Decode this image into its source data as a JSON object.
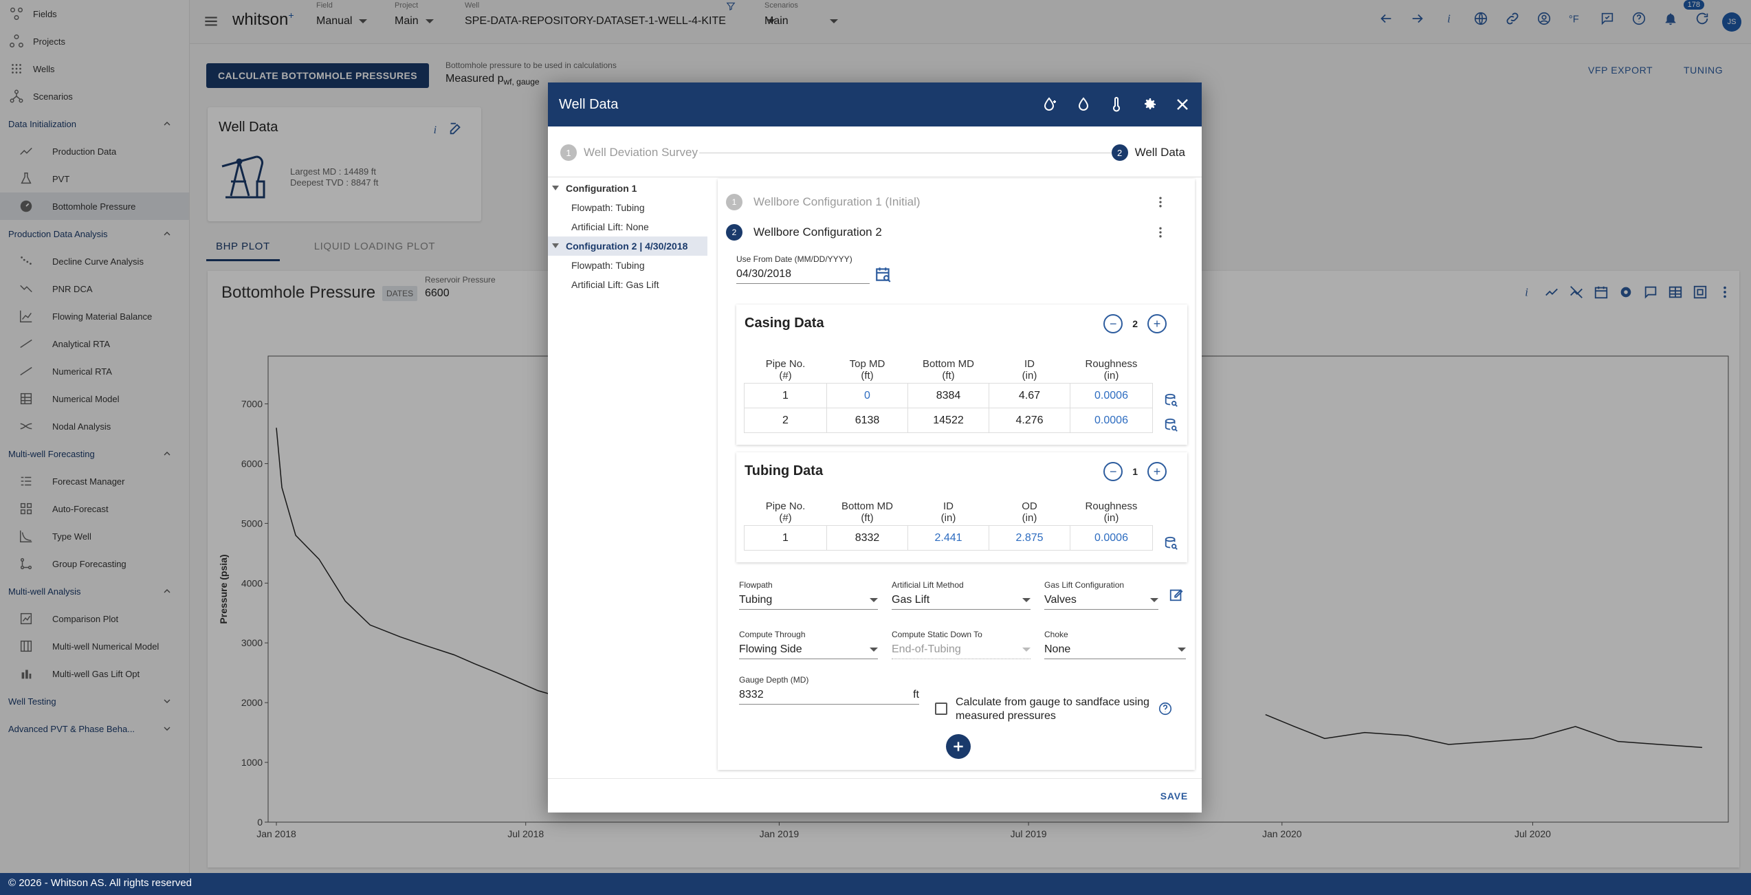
{
  "sidebar": {
    "top_items": [
      "Fields",
      "Projects",
      "Wells",
      "Scenarios"
    ],
    "sections": [
      {
        "title": "Data Initialization",
        "items": [
          "Production Data",
          "PVT",
          "Bottomhole Pressure"
        ]
      },
      {
        "title": "Production Data Analysis",
        "items": [
          "Decline Curve Analysis",
          "PNR DCA",
          "Flowing Material Balance",
          "Analytical RTA",
          "Numerical RTA",
          "Numerical Model",
          "Nodal Analysis"
        ]
      },
      {
        "title": "Multi-well Forecasting",
        "items": [
          "Forecast Manager",
          "Auto-Forecast",
          "Type Well",
          "Group Forecasting"
        ]
      },
      {
        "title": "Multi-well Analysis",
        "items": [
          "Comparison Plot",
          "Multi-well Numerical Model",
          "Multi-well Gas Lift Opt"
        ]
      },
      {
        "title": "Well Testing",
        "items": []
      },
      {
        "title": "Advanced PVT & Phase Beha...",
        "items": []
      }
    ],
    "active_item": "Bottomhole Pressure"
  },
  "topbar": {
    "logo": "whitson",
    "logo_sup": "+",
    "field_label": "Field",
    "field_value": "Manual",
    "project_label": "Project",
    "project_value": "Main",
    "well_label": "Well",
    "well_value": "SPE-DATA-REPOSITORY-DATASET-1-WELL-4-KITE",
    "scenarios_label": "Scenarios",
    "scenarios_value": "Main",
    "temp_unit": "°F",
    "notifications": "178",
    "user_initials": "JS"
  },
  "main": {
    "calc_button": "CALCULATE BOTTOMHOLE PRESSURES",
    "bhp_source_label": "Bottomhole pressure to be used in calculations",
    "bhp_source_value": "Measured p",
    "bhp_source_sub": "wf, gauge",
    "vfp_export": "VFP EXPORT",
    "tuning": "TUNING",
    "well_card_title": "Well Data",
    "largest_md": "Largest MD :  14489 ft",
    "deepest_tvd": "Deepest TVD :  8847 ft",
    "tabs": [
      "BHP PLOT",
      "LIQUID LOADING PLOT"
    ],
    "chart_title": "Bottomhole Pressure",
    "dates_chip": "DATES",
    "reservoir_pressure_label": "Reservoir Pressure",
    "reservoir_pressure_value": "6600"
  },
  "chart_data": {
    "type": "line",
    "title": "Bottomhole Pressure",
    "ylabel": "Pressure (psia)",
    "xlabel": "",
    "ylim": [
      0,
      7800
    ],
    "yticks": [
      0,
      1000,
      2000,
      3000,
      4000,
      5000,
      6000,
      7000
    ],
    "xticks": [
      "Jan 2018",
      "Jul 2018",
      "Jan 2019",
      "Jul 2019",
      "Jan 2020",
      "Jul 2020"
    ],
    "color": "#222222",
    "series": [
      {
        "x": [
          "2018-01-01",
          "2018-01-05",
          "2018-01-15",
          "2018-02-01",
          "2018-02-20",
          "2018-03-10",
          "2018-04-01",
          "2018-04-20",
          "2018-05-10",
          "2018-05-25",
          "2018-06-10",
          "2018-06-25",
          "2018-07-10",
          "2018-07-25"
        ],
        "values": [
          6600,
          5600,
          4800,
          4400,
          3700,
          3300,
          3100,
          2950,
          2800,
          2650,
          2500,
          2350,
          2200,
          2100
        ]
      },
      {
        "x": [
          "2019-12-20",
          "2020-01-10",
          "2020-02-01",
          "2020-03-01",
          "2020-04-01",
          "2020-05-01",
          "2020-06-01",
          "2020-07-01",
          "2020-08-01",
          "2020-09-01",
          "2020-10-01",
          "2020-11-01"
        ],
        "values": [
          1800,
          1600,
          1400,
          1500,
          1450,
          1300,
          1350,
          1400,
          1600,
          1350,
          1300,
          1250
        ]
      }
    ]
  },
  "modal": {
    "title": "Well Data",
    "steps": [
      {
        "num": "1",
        "label": "Well Deviation Survey"
      },
      {
        "num": "2",
        "label": "Well Data"
      }
    ],
    "tree": [
      {
        "label": "Configuration 1",
        "children": [
          "Flowpath: Tubing",
          "Artificial Lift: None"
        ]
      },
      {
        "label": "Configuration 2 | 4/30/2018",
        "children": [
          "Flowpath: Tubing",
          "Artificial Lift: Gas Lift"
        ]
      }
    ],
    "wellbore_configs": [
      {
        "num": "1",
        "label": "Wellbore Configuration 1 (Initial)"
      },
      {
        "num": "2",
        "label": "Wellbore Configuration 2"
      }
    ],
    "use_from_date_label": "Use From Date (MM/DD/YYYY)",
    "use_from_date_value": "04/30/2018",
    "casing": {
      "title": "Casing Data",
      "count": "2",
      "headers": [
        [
          "Pipe No.",
          "(#)"
        ],
        [
          "Top MD",
          "(ft)"
        ],
        [
          "Bottom MD",
          "(ft)"
        ],
        [
          "ID",
          "(in)"
        ],
        [
          "Roughness",
          "(in)"
        ]
      ],
      "rows": [
        [
          "1",
          "0",
          "8384",
          "4.67",
          "0.0006"
        ],
        [
          "2",
          "6138",
          "14522",
          "4.276",
          "0.0006"
        ]
      ]
    },
    "tubing": {
      "title": "Tubing Data",
      "count": "1",
      "headers": [
        [
          "Pipe No.",
          "(#)"
        ],
        [
          "Bottom MD",
          "(ft)"
        ],
        [
          "ID",
          "(in)"
        ],
        [
          "OD",
          "(in)"
        ],
        [
          "Roughness",
          "(in)"
        ]
      ],
      "rows": [
        [
          "1",
          "8332",
          "2.441",
          "2.875",
          "0.0006"
        ]
      ]
    },
    "flowpath_label": "Flowpath",
    "flowpath_value": "Tubing",
    "al_method_label": "Artificial Lift Method",
    "al_method_value": "Gas Lift",
    "gl_config_label": "Gas Lift Configuration",
    "gl_config_value": "Valves",
    "compute_through_label": "Compute Through",
    "compute_through_value": "Flowing Side",
    "compute_static_label": "Compute Static Down To",
    "compute_static_value": "End-of-Tubing",
    "choke_label": "Choke",
    "choke_value": "None",
    "gauge_depth_label": "Gauge Depth (MD)",
    "gauge_depth_value": "8332",
    "gauge_depth_unit": "ft",
    "calc_from_gauge_line1": "Calculate from gauge to sandface using",
    "calc_from_gauge_line2": "measured pressures",
    "save": "SAVE"
  },
  "footer": "© 2026 - Whitson AS. All rights reserved"
}
